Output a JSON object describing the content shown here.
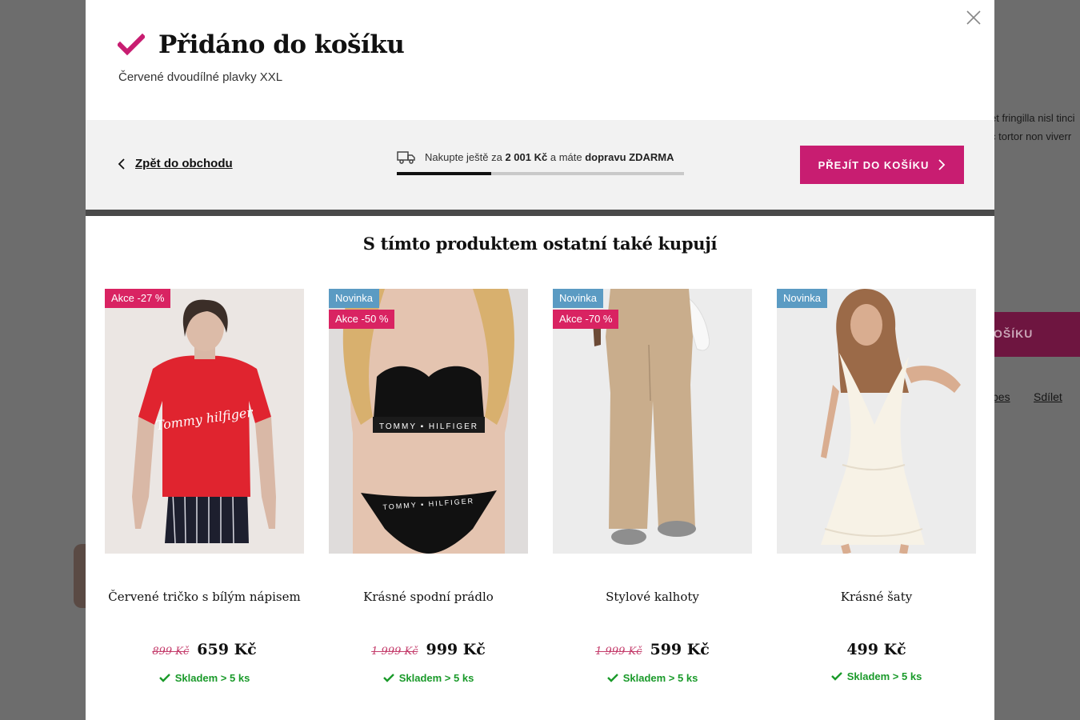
{
  "background": {
    "line1": "et fringilla nisl tinci",
    "line2": "c tortor non viverr",
    "cta_label": "OŠÍKU",
    "link1": "pes",
    "link2": "Sdílet"
  },
  "modal": {
    "title": "Přidáno do košíku",
    "subtitle": "Červené dvoudílné plavky XXL",
    "back_label": "Zpět do obchodu",
    "shipping": {
      "prefix": "Nakupte ještě za",
      "amount": "2 001 Kč",
      "middle": "a máte",
      "emphasis": "dopravu ZDARMA",
      "progress": 0.33
    },
    "cta_label": "PŘEJÍT DO KOŠÍKU",
    "section_title": "S tímto produktem ostatní také kupují",
    "accent_color": "#c81d71"
  },
  "products": [
    {
      "name": "Červené tričko s bílým nápisem",
      "badges": [
        "Akce -27 %"
      ],
      "badge_types": [
        "sale"
      ],
      "old_price": "899 Kč",
      "price": "659 Kč",
      "stock": "Skladem > 5 ks",
      "image": "red-tshirt-model"
    },
    {
      "name": "Krásné spodní prádlo",
      "badges": [
        "Novinka",
        "Akce -50 %"
      ],
      "badge_types": [
        "new",
        "sale"
      ],
      "old_price": "1 999 Kč",
      "price": "999 Kč",
      "stock": "Skladem > 5 ks",
      "image": "black-underwear-model"
    },
    {
      "name": "Stylové kalhoty",
      "badges": [
        "Novinka",
        "Akce -70 %"
      ],
      "badge_types": [
        "new",
        "sale"
      ],
      "old_price": "1 999 Kč",
      "price": "599 Kč",
      "stock": "Skladem > 5 ks",
      "image": "beige-trousers-model"
    },
    {
      "name": "Krásné šaty",
      "badges": [
        "Novinka"
      ],
      "badge_types": [
        "new"
      ],
      "old_price": "",
      "price": "499 Kč",
      "stock": "Skladem > 5 ks",
      "image": "white-dress-model"
    }
  ]
}
